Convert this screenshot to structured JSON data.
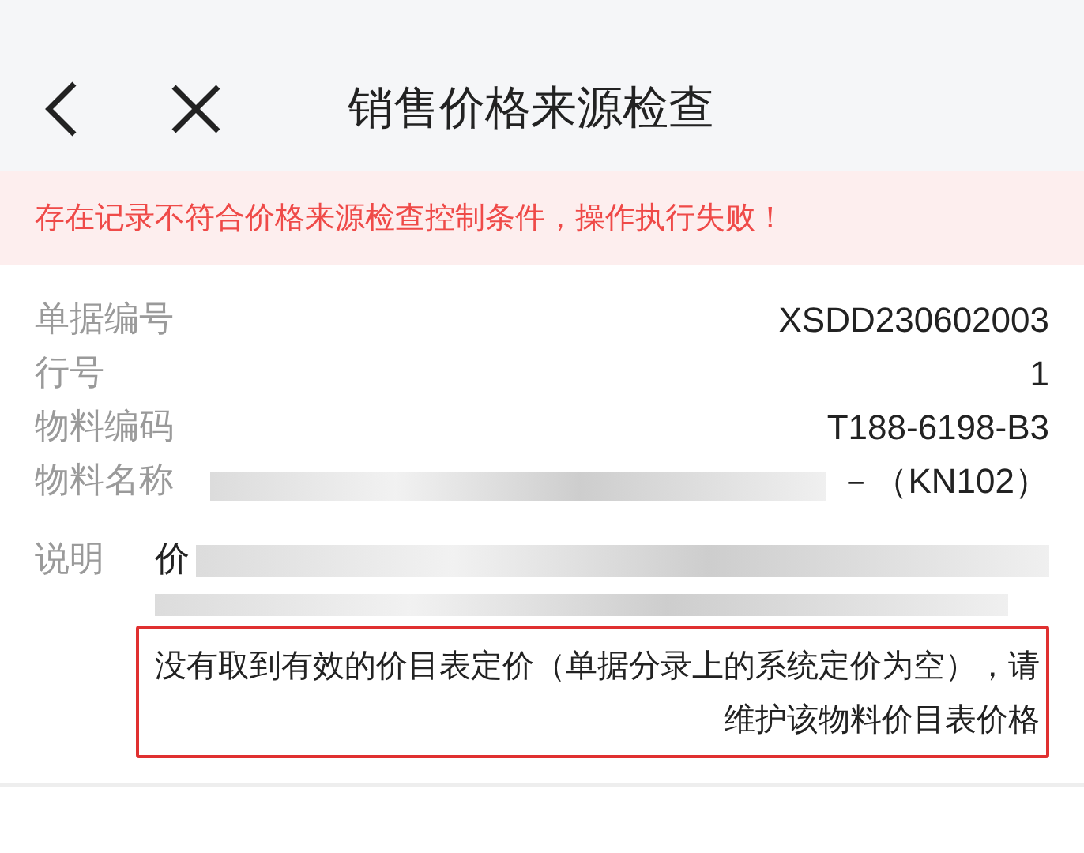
{
  "nav": {
    "title": "销售价格来源检查"
  },
  "error_banner": "存在记录不符合价格来源检查控制条件，操作执行失败！",
  "fields": [
    {
      "label": "单据编号",
      "value": "XSDD230602003"
    },
    {
      "label": "行号",
      "value": "1"
    },
    {
      "label": "物料编码",
      "value": "T188-6198-B3"
    },
    {
      "label": "物料名称",
      "value": "－（KN102）",
      "redacted": true
    }
  ],
  "description": {
    "label": "说明",
    "value_start": "价",
    "message": "没有取到有效的价目表定价（单据分录上的系统定价为空），请维护该物料价目表价格"
  }
}
